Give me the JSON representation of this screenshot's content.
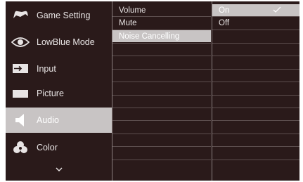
{
  "main_menu": {
    "items": [
      {
        "label": "Game Setting",
        "icon": "controller-icon"
      },
      {
        "label": "LowBlue Mode",
        "icon": "eye-icon"
      },
      {
        "label": "Input",
        "icon": "input-icon"
      },
      {
        "label": "Picture",
        "icon": "picture-icon"
      },
      {
        "label": "Audio",
        "icon": "speaker-icon",
        "selected": true
      },
      {
        "label": "Color",
        "icon": "palette-icon"
      }
    ],
    "more_icon": "chevron-down-icon"
  },
  "sub_menu": {
    "items": [
      {
        "label": "Volume"
      },
      {
        "label": "Mute"
      },
      {
        "label": "Noise Cancelling",
        "selected": true
      }
    ]
  },
  "options_menu": {
    "items": [
      {
        "label": "On",
        "selected": true,
        "checked": true
      },
      {
        "label": "Off"
      }
    ],
    "check_icon": "checkmark-icon"
  },
  "colors": {
    "background": "#2a1a1a",
    "highlight": "#c8c4c4",
    "text": "#e8e4e4",
    "separator": "#8a8080"
  }
}
